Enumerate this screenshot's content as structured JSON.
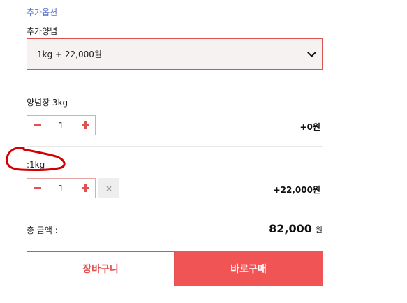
{
  "options": {
    "section_title": "추가옵션",
    "field_label": "추가양념",
    "select_value": "1kg  + 22,000원"
  },
  "items": [
    {
      "name": "양념장 3kg",
      "minus": "−",
      "quantity": "1",
      "plus": "+",
      "price": "+0원"
    },
    {
      "name": ":1kg",
      "minus": "−",
      "quantity": "1",
      "plus": "+",
      "remove": "×",
      "price": "+22,000원"
    }
  ],
  "total": {
    "label": "총 금액 :",
    "value": "82,000",
    "unit": "원"
  },
  "actions": {
    "cart_label": "장바구니",
    "buy_label": "바로구매"
  },
  "colors": {
    "accent": "#f05454",
    "section_title": "#5b73c9",
    "annotation": "#d40000"
  }
}
